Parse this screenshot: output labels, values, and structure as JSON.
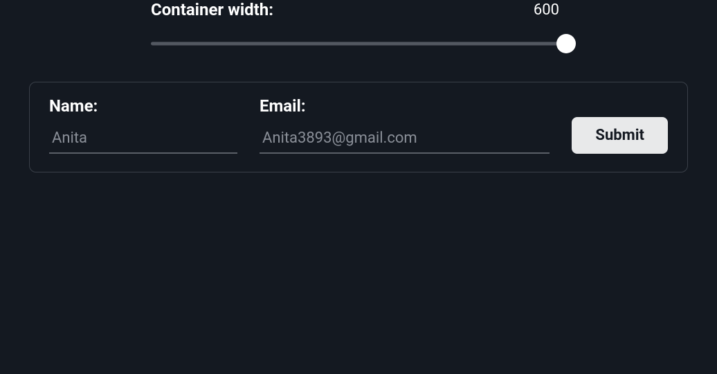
{
  "slider": {
    "label": "Container width:",
    "value": "600"
  },
  "form": {
    "name": {
      "label": "Name:",
      "placeholder": "Anita"
    },
    "email": {
      "label": "Email:",
      "placeholder": "Anita3893@gmail.com"
    },
    "submit_label": "Submit"
  }
}
